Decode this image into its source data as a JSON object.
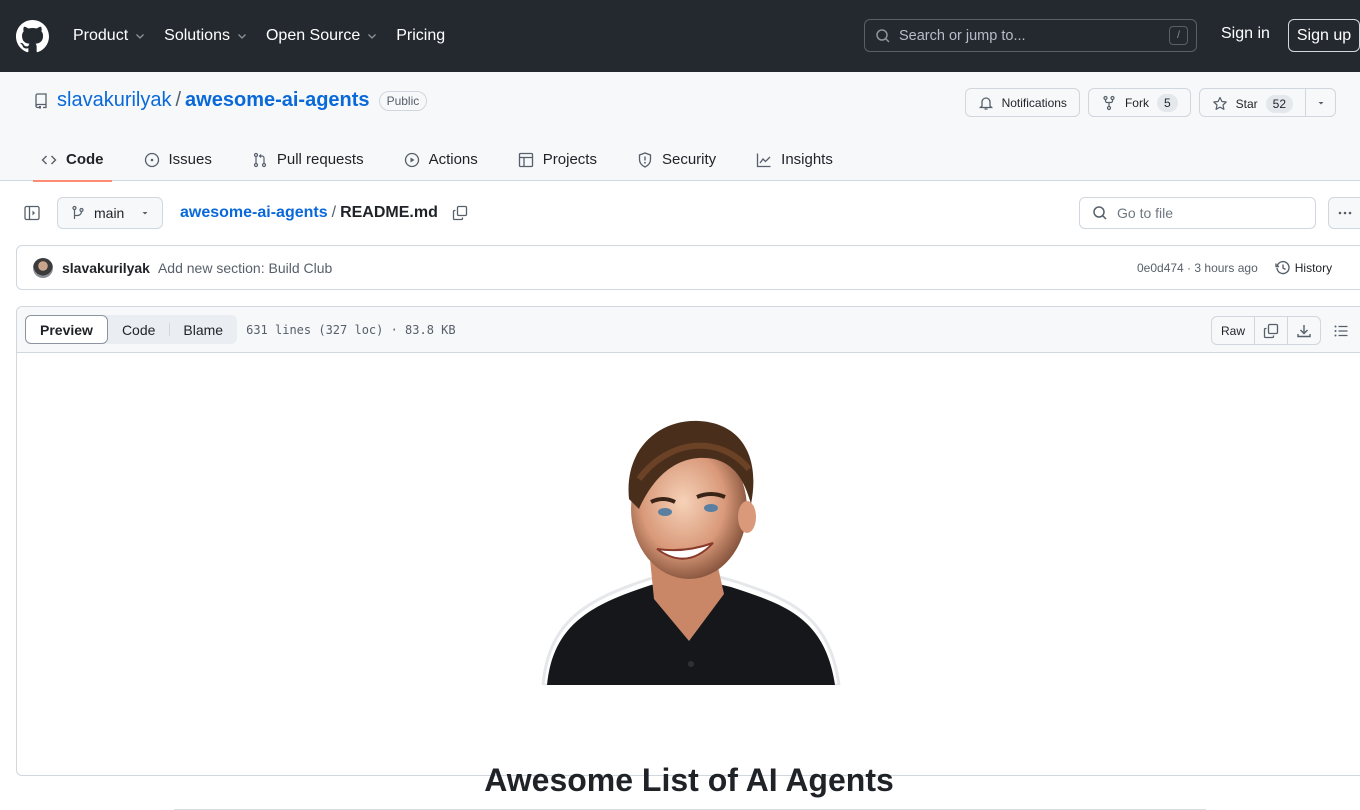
{
  "header": {
    "nav": [
      {
        "label": "Product",
        "dropdown": true
      },
      {
        "label": "Solutions",
        "dropdown": true
      },
      {
        "label": "Open Source",
        "dropdown": true
      },
      {
        "label": "Pricing",
        "dropdown": false
      }
    ],
    "search_placeholder": "Search or jump to...",
    "search_shortcut": "/",
    "sign_in": "Sign in",
    "sign_up": "Sign up"
  },
  "repo": {
    "owner": "slavakurilyak",
    "separator": "/",
    "name": "awesome-ai-agents",
    "visibility": "Public",
    "notifications_label": "Notifications",
    "fork_label": "Fork",
    "fork_count": "5",
    "star_label": "Star",
    "star_count": "52",
    "tabs": [
      {
        "label": "Code",
        "icon": "code-icon",
        "active": true
      },
      {
        "label": "Issues",
        "icon": "issue-icon",
        "active": false
      },
      {
        "label": "Pull requests",
        "icon": "pull-request-icon",
        "active": false
      },
      {
        "label": "Actions",
        "icon": "play-icon",
        "active": false
      },
      {
        "label": "Projects",
        "icon": "table-icon",
        "active": false
      },
      {
        "label": "Security",
        "icon": "shield-icon",
        "active": false
      },
      {
        "label": "Insights",
        "icon": "graph-icon",
        "active": false
      }
    ]
  },
  "filebar": {
    "branch": "main",
    "breadcrumb_repo": "awesome-ai-agents",
    "breadcrumb_sep": "/",
    "file_name": "README.md",
    "goto_placeholder": "Go to file"
  },
  "commit": {
    "author": "slavakurilyak",
    "message": "Add new section: Build Club",
    "sha": "0e0d474",
    "time": "3 hours ago",
    "meta": "0e0d474 · 3 hours ago",
    "history_label": "History"
  },
  "file": {
    "view_tabs": [
      "Preview",
      "Code",
      "Blame"
    ],
    "active_view": "Preview",
    "info": "631 lines (327 loc) · 83.8 KB",
    "raw_label": "Raw"
  },
  "readme": {
    "image_alt": "Illustrated portrait of a smiling man in a black shirt",
    "title": "Awesome List of AI Agents"
  },
  "colors": {
    "header_bg": "#24292f",
    "link": "#0969da",
    "active_tab_underline": "#fd8c73"
  }
}
